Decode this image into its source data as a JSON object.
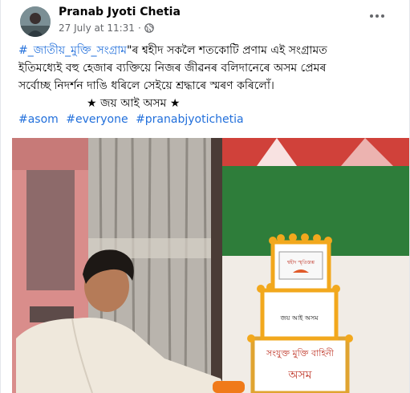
{
  "post": {
    "author": "Pranab Jyoti Chetia",
    "timestamp": "27 July at 11:31",
    "separator": "·",
    "line1_hashtag": "#_জাতীয়_মুক্তি_সংগ্ৰাম",
    "line1_rest": "\"ৰ শ্বহীদ সকলৈ শতকোটি প্ৰণাম এই সংগ্ৰামত",
    "line2": "ইতিমধ্যেই বহু হেজাৰ ব্যক্তিয়ে নিজৰ জীৱনৰ বলিদানেৰে অসম প্ৰেমৰ",
    "line3": "সৰ্বোচ্ছ নিদৰ্শন দাঙি ধৰিলে সেইয়ে শ্ৰদ্ধাৰে স্মৰণ কৰিলোঁ।",
    "line4": "★ জয় আই অসম ★",
    "hashtags": [
      "#asom",
      "#everyone",
      "#pranabjyotichetia"
    ]
  },
  "photo": {
    "box_top_text": "শ্বহীদ স্মৃতিস্তম্ভ",
    "box_mid_text": "জয় আই অসম",
    "box_bottom_line1": "সংযুক্ত মুক্তি বাহিনী",
    "box_bottom_line2": "অসম"
  },
  "icons": {
    "globe": "globe-icon",
    "more": "more-options-icon"
  },
  "colors": {
    "link": "#216fdb",
    "flag_red": "#d0413a",
    "flag_green": "#2e7d3a",
    "marigold": "#f2a81d"
  }
}
